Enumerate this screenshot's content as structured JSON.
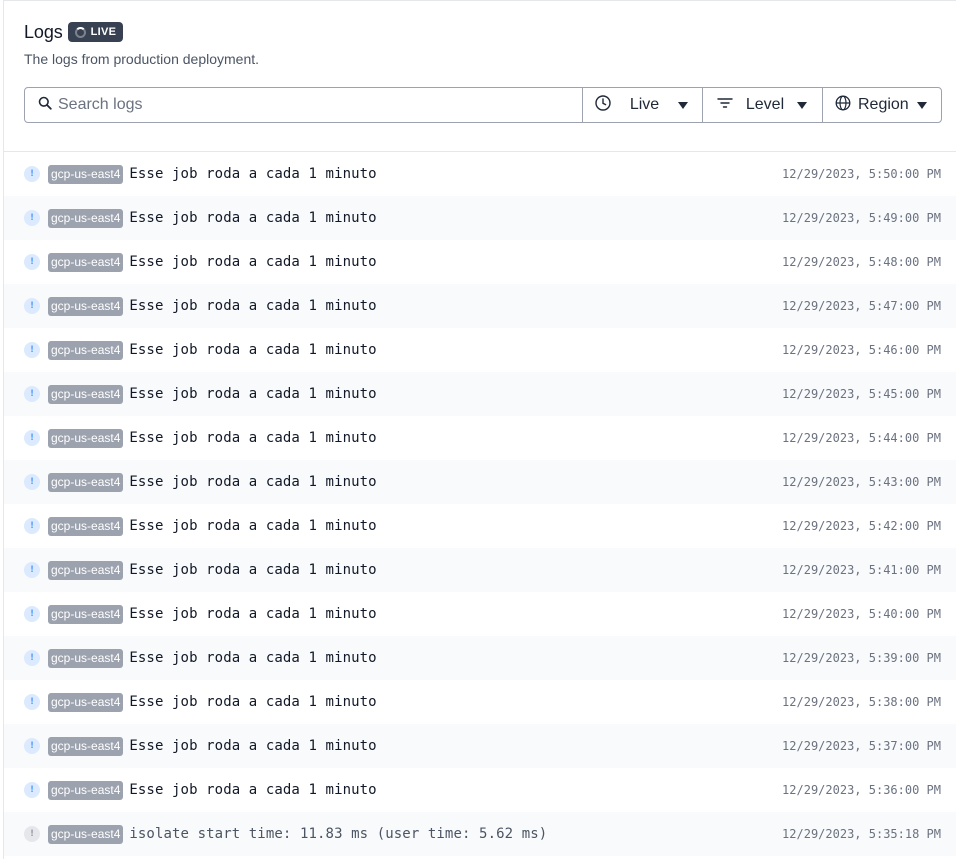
{
  "header": {
    "title": "Logs",
    "live_badge": "LIVE",
    "subtitle": "The logs from production deployment."
  },
  "toolbar": {
    "search_placeholder": "Search logs",
    "time_filter": "Live",
    "level_filter": "Level",
    "region_filter": "Region"
  },
  "logs": [
    {
      "region": "gcp-us-east4",
      "message": "Esse job roda a cada 1 minuto",
      "timestamp": "12/29/2023, 5:50:00 PM"
    },
    {
      "region": "gcp-us-east4",
      "message": "Esse job roda a cada 1 minuto",
      "timestamp": "12/29/2023, 5:49:00 PM"
    },
    {
      "region": "gcp-us-east4",
      "message": "Esse job roda a cada 1 minuto",
      "timestamp": "12/29/2023, 5:48:00 PM"
    },
    {
      "region": "gcp-us-east4",
      "message": "Esse job roda a cada 1 minuto",
      "timestamp": "12/29/2023, 5:47:00 PM"
    },
    {
      "region": "gcp-us-east4",
      "message": "Esse job roda a cada 1 minuto",
      "timestamp": "12/29/2023, 5:46:00 PM"
    },
    {
      "region": "gcp-us-east4",
      "message": "Esse job roda a cada 1 minuto",
      "timestamp": "12/29/2023, 5:45:00 PM"
    },
    {
      "region": "gcp-us-east4",
      "message": "Esse job roda a cada 1 minuto",
      "timestamp": "12/29/2023, 5:44:00 PM"
    },
    {
      "region": "gcp-us-east4",
      "message": "Esse job roda a cada 1 minuto",
      "timestamp": "12/29/2023, 5:43:00 PM"
    },
    {
      "region": "gcp-us-east4",
      "message": "Esse job roda a cada 1 minuto",
      "timestamp": "12/29/2023, 5:42:00 PM"
    },
    {
      "region": "gcp-us-east4",
      "message": "Esse job roda a cada 1 minuto",
      "timestamp": "12/29/2023, 5:41:00 PM"
    },
    {
      "region": "gcp-us-east4",
      "message": "Esse job roda a cada 1 minuto",
      "timestamp": "12/29/2023, 5:40:00 PM"
    },
    {
      "region": "gcp-us-east4",
      "message": "Esse job roda a cada 1 minuto",
      "timestamp": "12/29/2023, 5:39:00 PM"
    },
    {
      "region": "gcp-us-east4",
      "message": "Esse job roda a cada 1 minuto",
      "timestamp": "12/29/2023, 5:38:00 PM"
    },
    {
      "region": "gcp-us-east4",
      "message": "Esse job roda a cada 1 minuto",
      "timestamp": "12/29/2023, 5:37:00 PM"
    },
    {
      "region": "gcp-us-east4",
      "message": "Esse job roda a cada 1 minuto",
      "timestamp": "12/29/2023, 5:36:00 PM"
    },
    {
      "region": "gcp-us-east4",
      "message": "isolate start time: 11.83 ms (user time: 5.62 ms)",
      "timestamp": "12/29/2023, 5:35:18 PM",
      "muted": true
    }
  ],
  "icons": {
    "level": "info-icon",
    "level_glyph": "!",
    "search": "search-icon",
    "clock": "clock-icon",
    "filter": "filter-icon",
    "globe": "globe-icon"
  },
  "colors": {
    "badge_bg": "#374151",
    "region_tag_bg": "#9ca3af",
    "info_icon_bg": "#dbeafe",
    "info_icon_fg": "#60a5fa"
  }
}
